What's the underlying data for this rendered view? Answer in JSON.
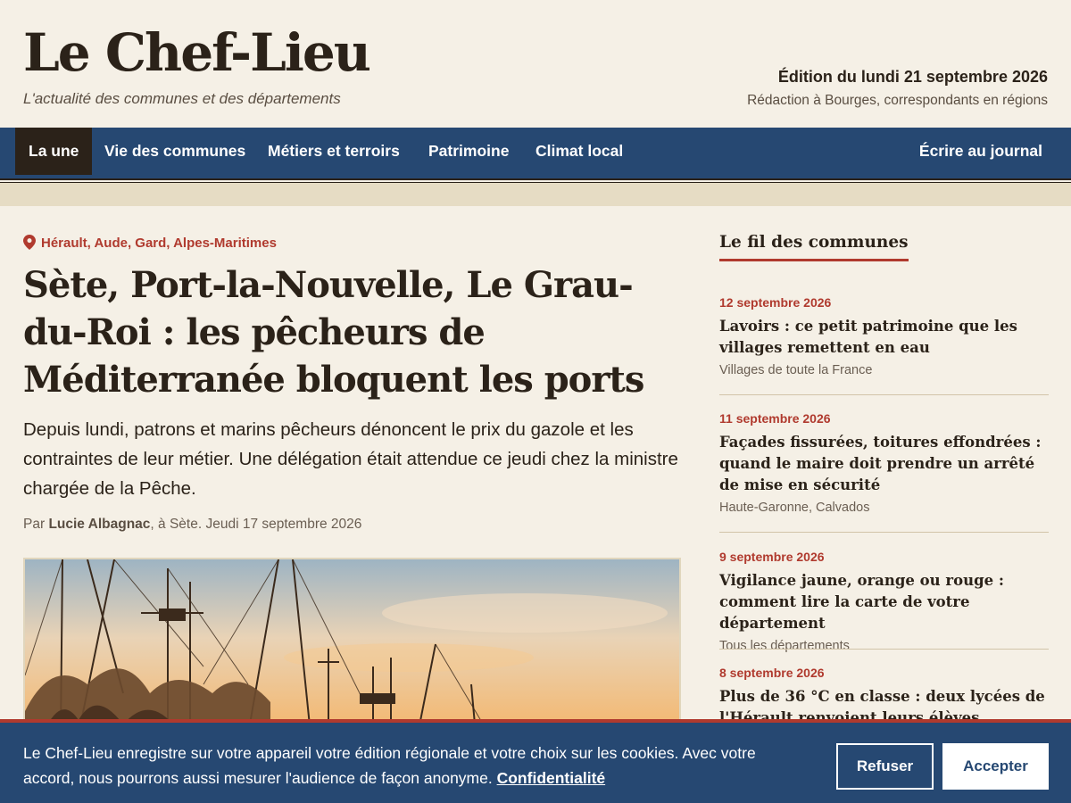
{
  "masthead": {
    "logo": "Le Chef-Lieu",
    "tagline": "L'actualité des communes et des départements",
    "edition": "Édition du lundi 21 septembre 2026",
    "redaction": "Rédaction à Bourges, correspondants en régions"
  },
  "nav": {
    "items": [
      {
        "label": "La une",
        "active": true
      },
      {
        "label": "Vie des communes"
      },
      {
        "label": "Métiers et terroirs"
      },
      {
        "label": "Patrimoine"
      },
      {
        "label": "Climat local"
      }
    ],
    "write_label": "Écrire au journal"
  },
  "article": {
    "kicker": "Hérault, Aude, Gard, Alpes-Maritimes",
    "headline": "Sète, Port-la-Nouvelle, Le Grau-du-Roi : les pêcheurs de Méditerranée bloquent les ports",
    "lede": "Depuis lundi, patrons et marins pêcheurs dénoncent le prix du gazole et les contraintes de leur métier. Une délégation était attendue ce jeudi chez la ministre chargée de la Pêche.",
    "byline_prefix": "Par",
    "author": "Lucie Albagnac",
    "byline_suffix": ", à Sète. Jeudi 17 septembre 2026"
  },
  "sidebar": {
    "title": "Le fil des communes",
    "items": [
      {
        "date": "12 septembre 2026",
        "title": "Lavoirs : ce petit patrimoine que les villages remettent en eau",
        "meta": "Villages de toute la France"
      },
      {
        "date": "11 septembre 2026",
        "title": "Façades fissurées, toitures effondrées : quand le maire doit prendre un arrêté de mise en sécurité",
        "meta": "Haute-Garonne, Calvados"
      },
      {
        "date": "9 septembre 2026",
        "title": "Vigilance jaune, orange ou rouge : comment lire la carte de votre département",
        "meta": "Tous les départements"
      },
      {
        "date": "8 septembre 2026",
        "title": "Plus de 36 °C en classe : deux lycées de l'Hérault renvoient leurs élèves",
        "meta": ""
      }
    ]
  },
  "cookie": {
    "text": "Le Chef-Lieu enregistre sur votre appareil votre édition régionale et votre choix sur les cookies. Avec votre accord, nous pourrons aussi mesurer l'audience de façon anonyme.",
    "link": "Confidentialité",
    "refuse": "Refuser",
    "accept": "Accepter"
  }
}
